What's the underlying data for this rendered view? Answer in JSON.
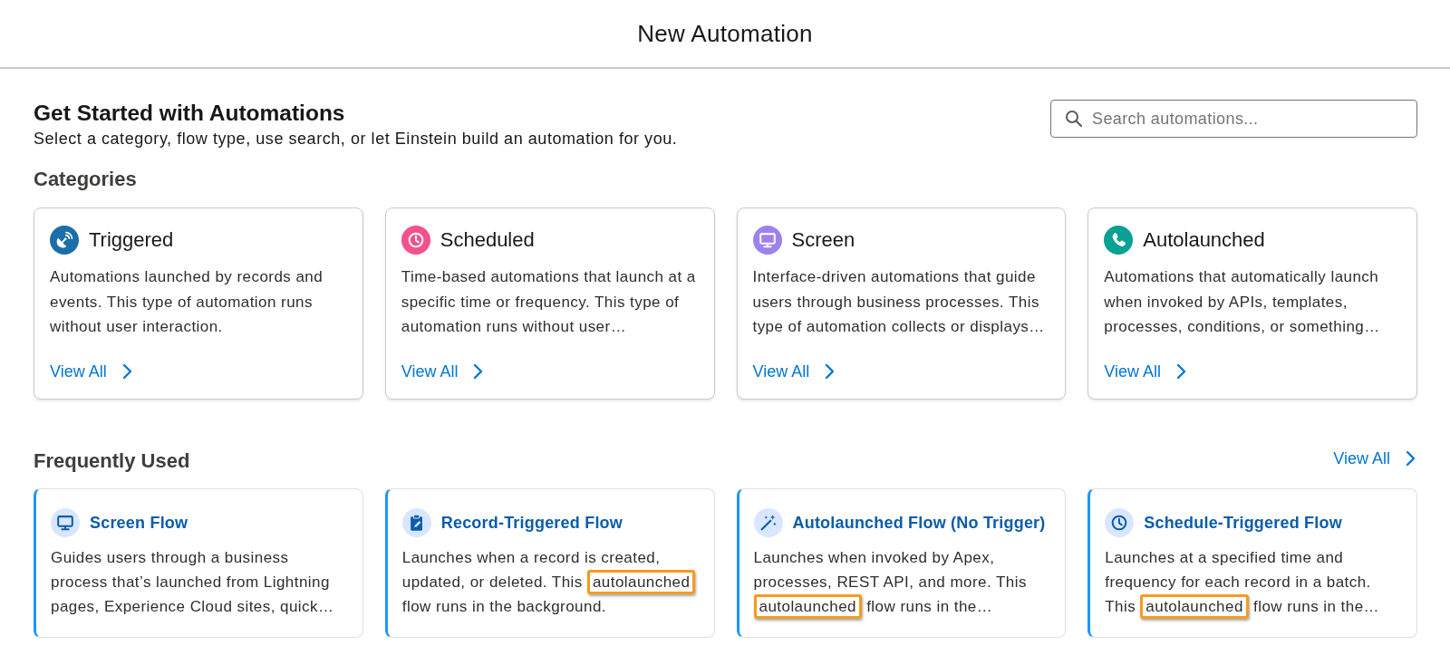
{
  "header": {
    "title": "New Automation"
  },
  "intro": {
    "title": "Get Started with Automations",
    "subtitle": "Select a category, flow type, use search, or let Einstein build an automation for you."
  },
  "search": {
    "placeholder": "Search automations..."
  },
  "categories": {
    "heading": "Categories",
    "items": [
      {
        "kind": "triggered",
        "title": "Triggered",
        "color": "#1b6ea8",
        "description": "Automations launched by records and events. This type of automation runs without user interaction.",
        "link": "View All"
      },
      {
        "kind": "scheduled",
        "title": "Scheduled",
        "color": "#f4508a",
        "description": "Time-based automations that launch at a specific time or frequency. This type of automation runs without user…",
        "link": "View All"
      },
      {
        "kind": "screen",
        "title": "Screen",
        "color": "#9e80ef",
        "description": "Interface-driven automations that guide users through business processes. This type of automation collects or displays…",
        "link": "View All"
      },
      {
        "kind": "autolaunched",
        "title": "Autolaunched",
        "color": "#08a193",
        "description": "Automations that automatically launch when invoked by APIs, templates, processes, conditions, or something…",
        "link": "View All"
      }
    ]
  },
  "frequently_used": {
    "heading": "Frequently Used",
    "link": "View All",
    "items": [
      {
        "kind": "screen",
        "title": "Screen Flow",
        "description": [
          {
            "text": "Guides users through a business process that’s launched from Lightning pages, Experience Cloud sites, quick…",
            "highlighted": false
          }
        ]
      },
      {
        "kind": "record_triggered",
        "title": "Record-Triggered Flow",
        "description": [
          {
            "text": "Launches when a record is created, updated, or deleted. This ",
            "highlighted": false
          },
          {
            "text": "autolaunched",
            "highlighted": true
          },
          {
            "text": " flow runs in the background.",
            "highlighted": false
          }
        ]
      },
      {
        "kind": "autolaunched",
        "title": "Autolaunched Flow (No Trigger)",
        "description": [
          {
            "text": "Launches when invoked by Apex, processes, REST API, and more. This ",
            "highlighted": false
          },
          {
            "text": "autolaunched",
            "highlighted": true
          },
          {
            "text": " flow runs in the…",
            "highlighted": false
          }
        ]
      },
      {
        "kind": "schedule_triggered",
        "title": "Schedule-Triggered Flow",
        "description": [
          {
            "text": "Launches at a specified time and frequency for each record in a batch. This ",
            "highlighted": false
          },
          {
            "text": "autolaunched",
            "highlighted": true
          },
          {
            "text": " flow runs in the…",
            "highlighted": false
          }
        ]
      }
    ]
  }
}
